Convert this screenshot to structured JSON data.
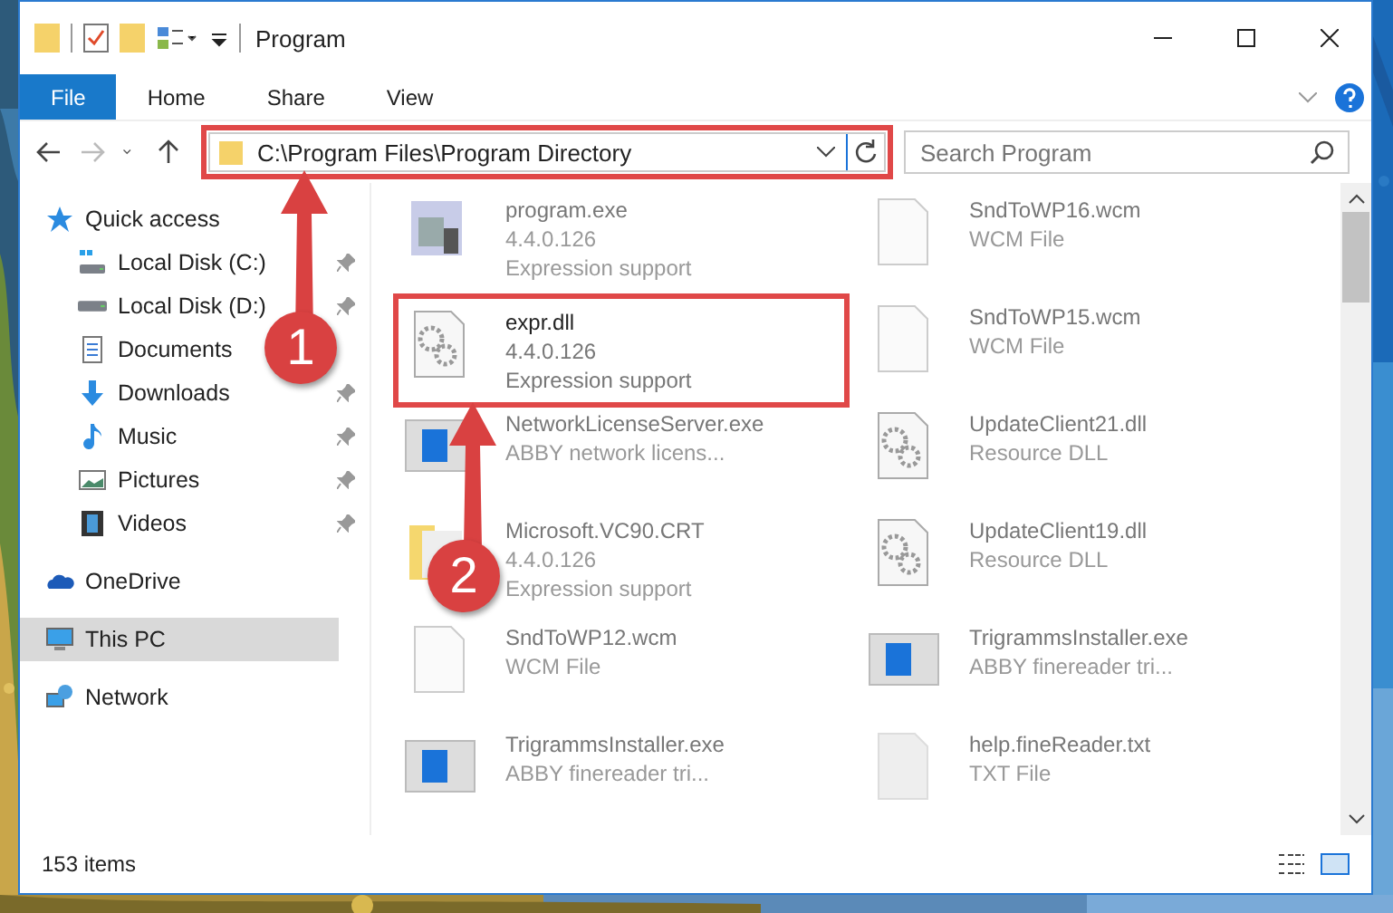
{
  "window": {
    "title": "Program"
  },
  "ribbon_tabs": [
    {
      "label": "File",
      "selected": true
    },
    {
      "label": "Home",
      "selected": false
    },
    {
      "label": "Share",
      "selected": false
    },
    {
      "label": "View",
      "selected": false
    }
  ],
  "address": {
    "value": "C:\\Program Files\\Program Directory",
    "marked": true
  },
  "search": {
    "placeholder": "Search Program"
  },
  "sidebar": {
    "items": [
      {
        "label": "Quick access",
        "kind": "star",
        "selected": false,
        "children": [
          {
            "label": "Local Disk (C:)",
            "kind": "disk-c",
            "pinned": true,
            "selected": false
          },
          {
            "label": "Local Disk (D:)",
            "kind": "disk",
            "pinned": true,
            "selected": false
          },
          {
            "label": "Documents",
            "kind": "doc",
            "pinned": false,
            "selected": false
          },
          {
            "label": "Downloads",
            "kind": "download",
            "pinned": true,
            "selected": false
          },
          {
            "label": "Music",
            "kind": "music",
            "pinned": true,
            "selected": false
          },
          {
            "label": "Pictures",
            "kind": "pictures",
            "pinned": true,
            "selected": false
          },
          {
            "label": "Videos",
            "kind": "videos",
            "pinned": true,
            "selected": false
          }
        ]
      },
      {
        "label": "OneDrive",
        "kind": "cloud",
        "selected": false
      },
      {
        "label": "This PC",
        "kind": "pc",
        "selected": true
      },
      {
        "label": "Network",
        "kind": "network",
        "selected": false
      }
    ]
  },
  "files": [
    {
      "name": "program.exe",
      "lines": [
        "4.4.0.126",
        "Expression support"
      ],
      "kind": "program",
      "marked": false
    },
    {
      "name": "SndToWP16.wcm",
      "lines": [
        "WCM File"
      ],
      "kind": "blank",
      "marked": false
    },
    {
      "name": "expr.dll",
      "lines": [
        "4.4.0.126",
        "Expression support"
      ],
      "kind": "dll",
      "marked": true
    },
    {
      "name": "SndToWP15.wcm",
      "lines": [
        "WCM File"
      ],
      "kind": "blank",
      "marked": false
    },
    {
      "name": "NetworkLicenseServer.exe",
      "lines": [
        "ABBY network licens..."
      ],
      "kind": "app",
      "marked": false
    },
    {
      "name": "UpdateClient21.dll",
      "lines": [
        "Resource DLL"
      ],
      "kind": "dll",
      "marked": false
    },
    {
      "name": "Microsoft.VC90.CRT",
      "lines": [
        "4.4.0.126",
        "Expression support"
      ],
      "kind": "folder",
      "marked": false
    },
    {
      "name": "UpdateClient19.dll",
      "lines": [
        "Resource DLL"
      ],
      "kind": "dll",
      "marked": false
    },
    {
      "name": "SndToWP12.wcm",
      "lines": [
        "WCM File"
      ],
      "kind": "blank",
      "marked": false
    },
    {
      "name": "TrigrammsInstaller.exe",
      "lines": [
        "ABBY finereader tri..."
      ],
      "kind": "app",
      "marked": false
    },
    {
      "name": "TrigrammsInstaller.exe",
      "lines": [
        "ABBY finereader tri..."
      ],
      "kind": "app",
      "marked": false
    },
    {
      "name": "help.fineReader.txt",
      "lines": [
        "TXT File"
      ],
      "kind": "text",
      "marked": false
    }
  ],
  "status_bar": {
    "count": "153 items"
  },
  "callouts": [
    {
      "number": "1"
    },
    {
      "number": "2"
    }
  ]
}
